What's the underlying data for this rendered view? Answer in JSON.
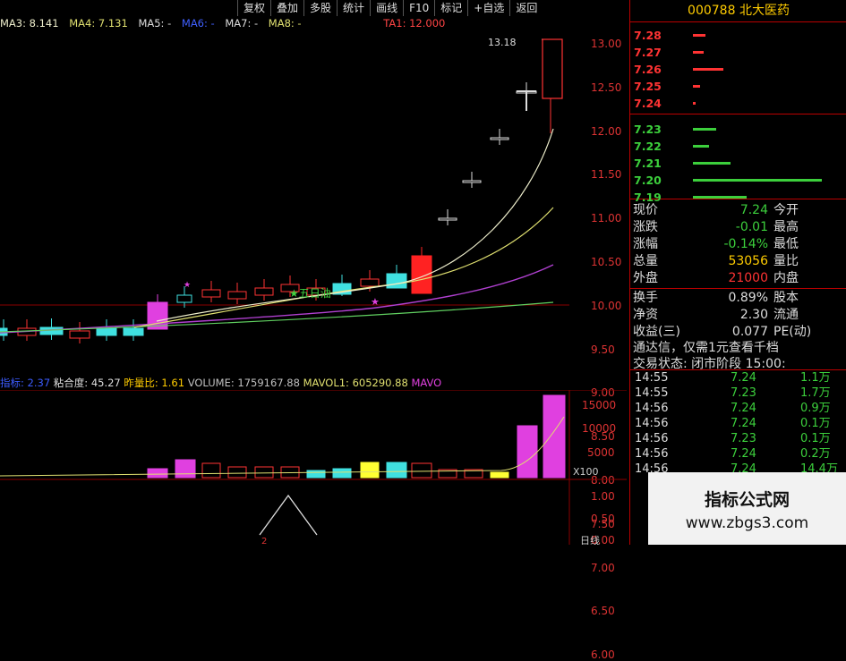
{
  "toolbar": {
    "buttons": [
      "复权",
      "叠加",
      "多股",
      "统计",
      "画线",
      "F10",
      "标记",
      "+自选",
      "返回"
    ]
  },
  "ma": {
    "ma3": "MA3: 8.141",
    "ma4": "MA4: 7.131",
    "ma5": "MA5: -",
    "ma6": "MA6: -",
    "ma7": "MA7: -",
    "ma8": "MA8: -",
    "ta1": "TA1: 12.000"
  },
  "price_axis": {
    "ticks": [
      "13.00",
      "12.50",
      "12.00",
      "11.50",
      "11.00",
      "10.50",
      "10.00",
      "9.50",
      "9.00",
      "8.50",
      "8.00",
      "7.50",
      "7.00",
      "6.50",
      "6.00"
    ]
  },
  "chart": {
    "high_label": "13.18",
    "annotation_star": "★五日油",
    "colors": {
      "up": "#ff2222",
      "down": "#40e0e0",
      "ma_white": "#eeeecc",
      "ma_yellow": "#e0e070",
      "ma_purple": "#b040d0",
      "ma_green": "#60d060"
    }
  },
  "volume": {
    "header": {
      "indicator": "指标: 2.37",
      "stickiness": "粘合度: 45.27",
      "ratio": "昨量比: 1.61",
      "volume": "VOLUME: 1759167.88",
      "mavol1": "MAVOL1: 605290.88",
      "mavol2": "MAVO"
    },
    "ticks": [
      "15000",
      "10000",
      "5000"
    ],
    "unit": "X100",
    "lower_ticks": [
      "1.00",
      "0.50",
      "0.00"
    ],
    "lower_marker": "2",
    "timeframe": "日线"
  },
  "stock": {
    "code": "000788",
    "name": "北大医药"
  },
  "orderbook": {
    "asks": [
      {
        "price": "7.28",
        "size": 0.07
      },
      {
        "price": "7.27",
        "size": 0.06
      },
      {
        "price": "7.26",
        "size": 0.17
      },
      {
        "price": "7.25",
        "size": 0.04
      },
      {
        "price": "7.24",
        "size": 0.01
      }
    ],
    "bids": [
      {
        "price": "7.23",
        "size": 0.13
      },
      {
        "price": "7.22",
        "size": 0.09
      },
      {
        "price": "7.21",
        "size": 0.21
      },
      {
        "price": "7.20",
        "size": 0.72
      },
      {
        "price": "7.19",
        "size": 0.3
      }
    ]
  },
  "quote": {
    "rows": [
      {
        "l1": "现价",
        "v": "7.24",
        "l2": "今开",
        "color": "#3ccf3c"
      },
      {
        "l1": "涨跌",
        "v": "-0.01",
        "l2": "最高",
        "color": "#3ccf3c"
      },
      {
        "l1": "涨幅",
        "v": "-0.14%",
        "l2": "最低",
        "color": "#3ccf3c"
      },
      {
        "l1": "总量",
        "v": "53056",
        "l2": "量比",
        "color": "#ffcc00"
      },
      {
        "l1": "外盘",
        "v": "21000",
        "l2": "内盘",
        "color": "#ff3333"
      },
      {
        "l1": "换手",
        "v": "0.89%",
        "l2": "股本",
        "color": "#dddddd"
      },
      {
        "l1": "净资",
        "v": "2.30",
        "l2": "流通",
        "color": "#dddddd"
      },
      {
        "l1": "收益(三)",
        "v": "0.077",
        "l2": "PE(动)",
        "color": "#dddddd"
      }
    ],
    "ad": "通达信，仅需1元查看千档",
    "status": "交易状态: 闭市阶段 15:00:"
  },
  "ticks": [
    {
      "time": "14:55",
      "price": "7.24",
      "vol": "1.1万"
    },
    {
      "time": "14:55",
      "price": "7.23",
      "vol": "1.7万"
    },
    {
      "time": "14:56",
      "price": "7.24",
      "vol": "0.9万"
    },
    {
      "time": "14:56",
      "price": "7.24",
      "vol": "0.1万"
    },
    {
      "time": "14:56",
      "price": "7.23",
      "vol": "0.1万"
    },
    {
      "time": "14:56",
      "price": "7.24",
      "vol": "0.2万"
    },
    {
      "time": "14:56",
      "price": "7.24",
      "vol": "14.4万"
    }
  ],
  "watermark": {
    "title": "指标公式网",
    "url": "www.zbgs3.com"
  }
}
